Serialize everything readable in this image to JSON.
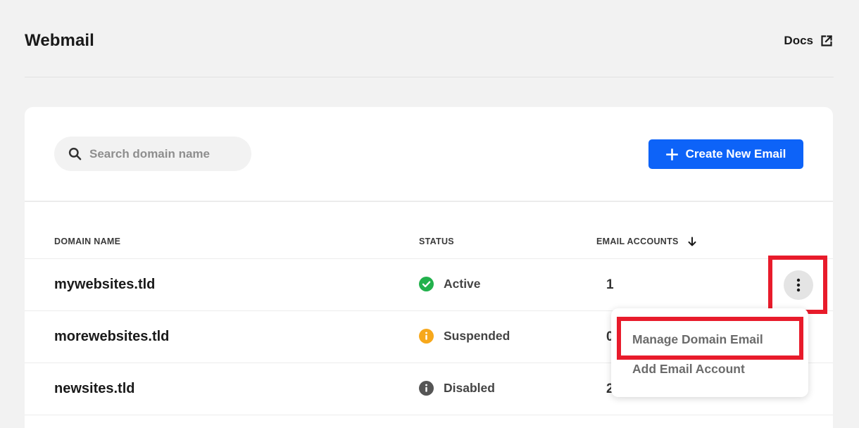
{
  "header": {
    "title": "Webmail",
    "docs_label": "Docs",
    "docs_icon": "external-link-icon"
  },
  "toolbar": {
    "search_placeholder": "Search domain name",
    "search_icon": "search-icon",
    "create_label": "Create New Email",
    "create_icon": "plus-icon"
  },
  "table": {
    "columns": {
      "domain": "DOMAIN NAME",
      "status": "STATUS",
      "accounts": "EMAIL ACCOUNTS"
    },
    "sort_icon": "arrow-down-icon",
    "rows": [
      {
        "domain": "mywebsites.tld",
        "status": "Active",
        "status_icon": "check-circle-icon",
        "accounts": "1"
      },
      {
        "domain": "morewebsites.tld",
        "status": "Suspended",
        "status_icon": "info-circle-icon",
        "accounts": "0"
      },
      {
        "domain": "newsites.tld",
        "status": "Disabled",
        "status_icon": "info-circle-icon",
        "accounts": "2"
      }
    ]
  },
  "row_menu": {
    "trigger_icon": "kebab-menu-icon",
    "items": [
      {
        "label": "Manage Domain Email"
      },
      {
        "label": "Add Email Account"
      }
    ]
  },
  "colors": {
    "accent": "#0d63f8",
    "active": "#22b14c",
    "suspended": "#f7a81b",
    "disabled": "#555555",
    "highlight": "#e81b2b"
  }
}
